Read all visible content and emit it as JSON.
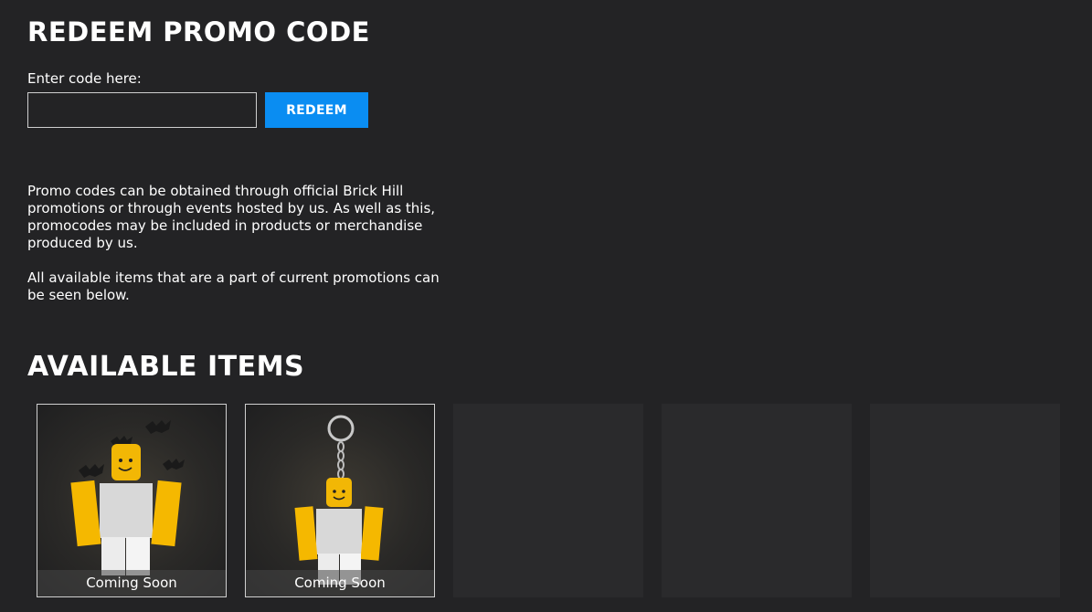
{
  "page": {
    "title": "REDEEM PROMO CODE",
    "code_label": "Enter code here:",
    "code_value": "",
    "redeem_label": "REDEEM",
    "info_paragraph_1": "Promo codes can be obtained through official Brick Hill promotions or through events hosted by us. As well as this, promocodes may be included in products or merchandise produced by us.",
    "info_paragraph_2": "All available items that are a part of current promotions can be seen below."
  },
  "available_items": {
    "title": "AVAILABLE ITEMS",
    "items": [
      {
        "caption": "Coming Soon",
        "icon": "bat-character-icon"
      },
      {
        "caption": "Coming Soon",
        "icon": "keychain-character-icon"
      }
    ]
  },
  "colors": {
    "background": "#232325",
    "accent": "#0a8df2",
    "card_empty": "#2a2a2c"
  }
}
